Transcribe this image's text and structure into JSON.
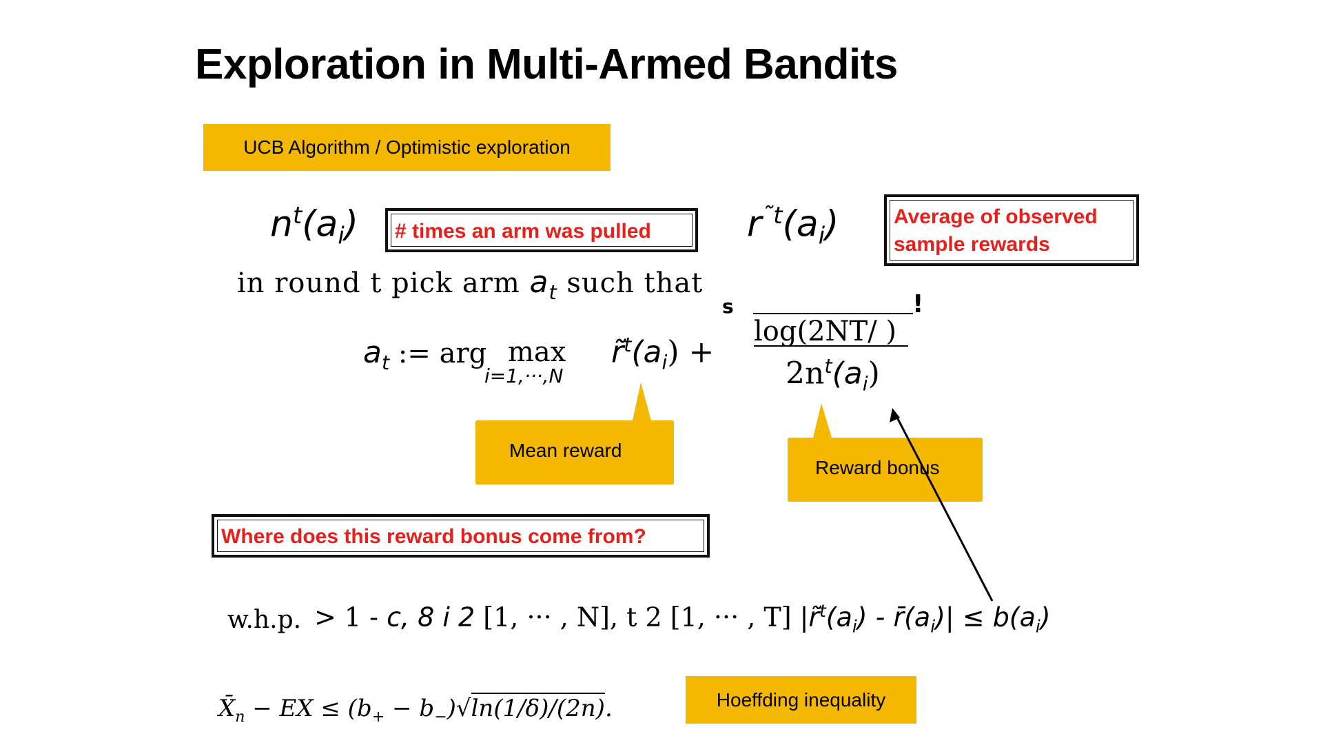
{
  "slide": {
    "title": "Exploration in Multi-Armed Bandits",
    "ucb_label": "UCB Algorithm / Optimistic exploration",
    "n_symbol": {
      "base": "n",
      "sup": "t",
      "arg": "(a",
      "sub": "i",
      "close": ")"
    },
    "times_pulled": "# times an arm was pulled",
    "r_symbol": {
      "base": "r",
      "sup": "˜t",
      "arg": "(a",
      "sub": "i",
      "close": ")"
    },
    "avg_rewards_line1": "Average of observed",
    "avg_rewards_line2": "sample rewards",
    "pick_text_before": "in round t pick arm",
    "pick_var": "a",
    "pick_var_sub": "t",
    "pick_text_after": "such that",
    "formula": {
      "lhs": "a",
      "lhs_sub": "t",
      "assign": " := arg",
      "max": "max",
      "max_sub": "i=1,···,N",
      "mean_term": "r̃",
      "mean_sup": "t",
      "mean_arg": "(a",
      "mean_sub": "i",
      "mean_close": ") +",
      "sqrt_s": "s",
      "excl": "!",
      "numerator": "log(2NT/ )",
      "denominator": "2n",
      "den_sup": "t",
      "den_arg": "(a",
      "den_sub": "i",
      "den_close": ")"
    },
    "mean_reward": "Mean reward",
    "reward_bonus": "Reward bonus",
    "question": "Where does this reward bonus come from?",
    "whp": {
      "prefix": "w.h.p.",
      "part1": " > 1 -  ",
      "part2": "c, 8 i 2 ",
      "part3": "[1, ··· , N], t 2 [1, ··· , T]",
      "part4": "  |r̃",
      "part4_sup": "t",
      "part5": "(a",
      "part5_sub": "i",
      "part6": ") -  r̄(a",
      "part6_sub": "i",
      "part7": ")| ≤ b(a",
      "part7_sub": "i",
      "part8": ")"
    },
    "hoeffding": {
      "lhs": "X̄",
      "lhs_sub": "n",
      "mid": " − EX ≤ (b",
      "bplus": "+",
      "minus": " − b",
      "bminus": "−",
      "close": ")",
      "radicand": "ln(1/δ)/(2n)",
      "end": "."
    },
    "hoeffding_label": "Hoeffding inequality"
  }
}
